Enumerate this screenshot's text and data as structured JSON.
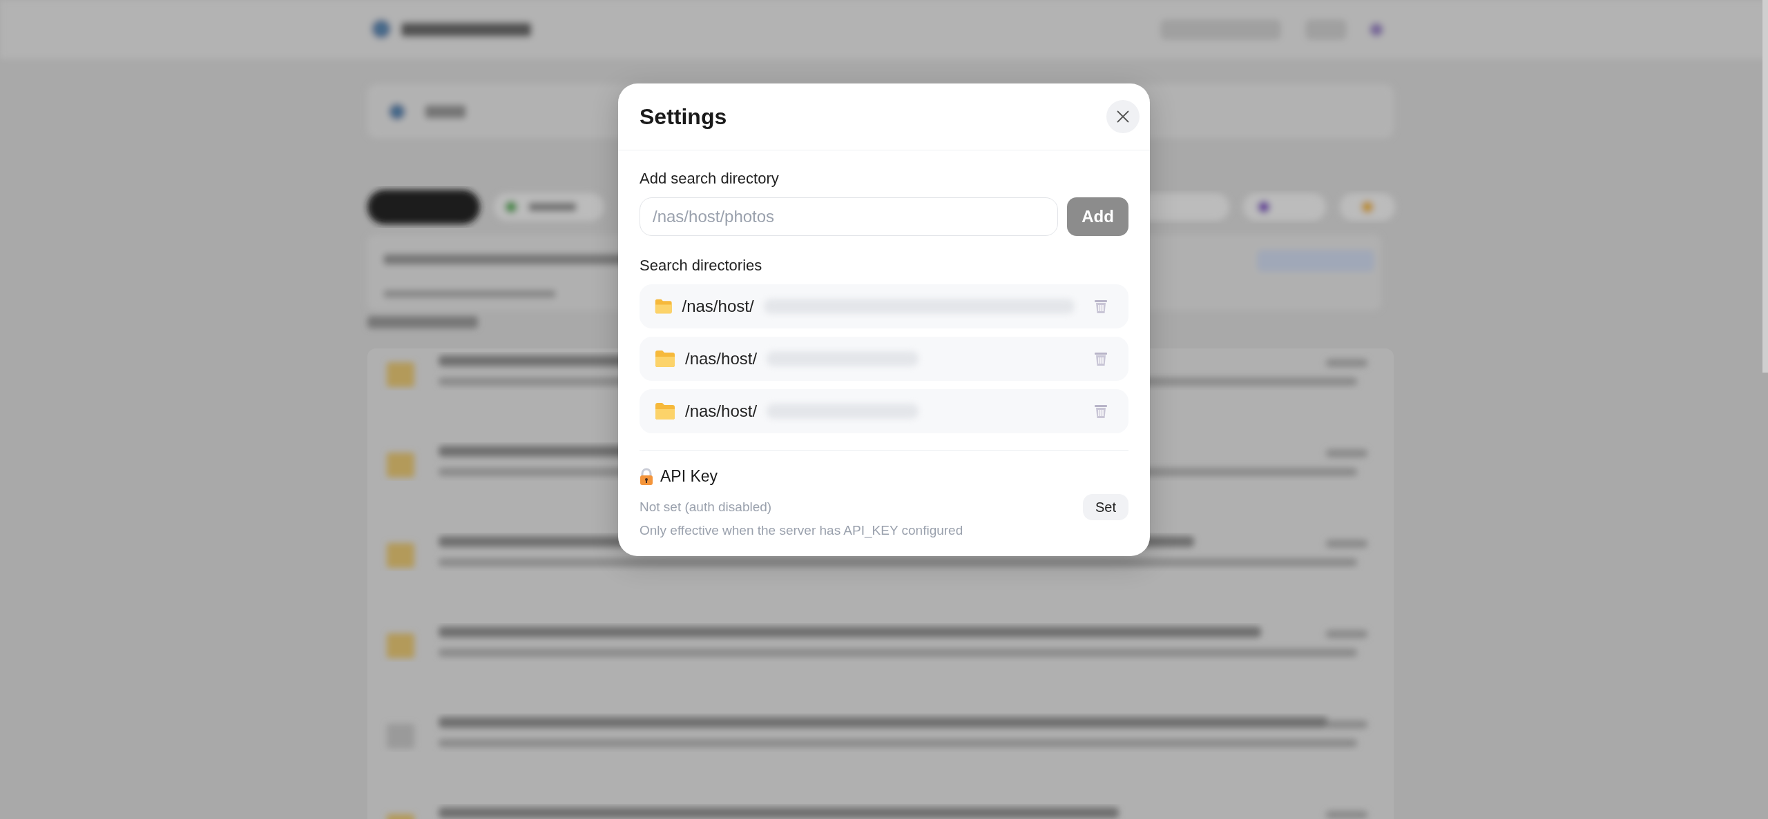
{
  "dialog": {
    "title": "Settings",
    "add_directory": {
      "label": "Add search directory",
      "placeholder": "/nas/host/photos",
      "button": "Add"
    },
    "directories": {
      "label": "Search directories",
      "items": [
        {
          "path": "/nas/host/",
          "redacted": true
        },
        {
          "path": "/nas/host/",
          "redacted": true
        },
        {
          "path": "/nas/host/",
          "redacted": true
        }
      ]
    },
    "api_key": {
      "title": "API Key",
      "status": "Not set (auth disabled)",
      "button": "Set",
      "note": "Only effective when the server has API_KEY configured"
    }
  }
}
